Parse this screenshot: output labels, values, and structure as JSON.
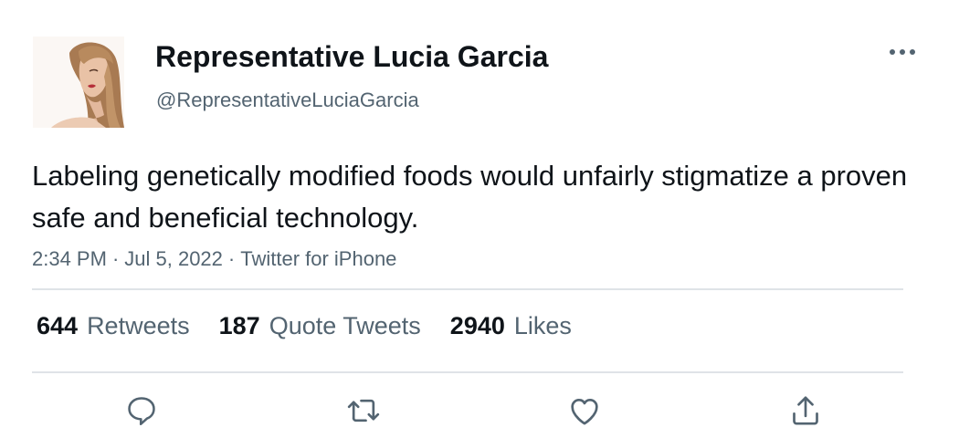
{
  "author": {
    "display_name": "Representative Lucia Garcia",
    "handle": "@RepresentativeLuciaGarcia",
    "avatar_icon": "profile-photo"
  },
  "tweet": {
    "text": "Labeling genetically modified foods would unfairly stigmatize a proven safe and beneficial technology.",
    "time": "2:34 PM",
    "date": "Jul 5, 2022",
    "source": "Twitter for iPhone",
    "separator": "·"
  },
  "stats": {
    "retweets_count": "644",
    "retweets_label": "Retweets",
    "quote_tweets_count": "187",
    "quote_tweets_label": "Quote Tweets",
    "likes_count": "2940",
    "likes_label": "Likes"
  },
  "actions": [
    "reply-icon",
    "retweet-icon",
    "like-icon",
    "share-icon"
  ],
  "colors": {
    "text": "#0f1419",
    "secondary": "#536471",
    "divider": "#dfe3e7"
  }
}
